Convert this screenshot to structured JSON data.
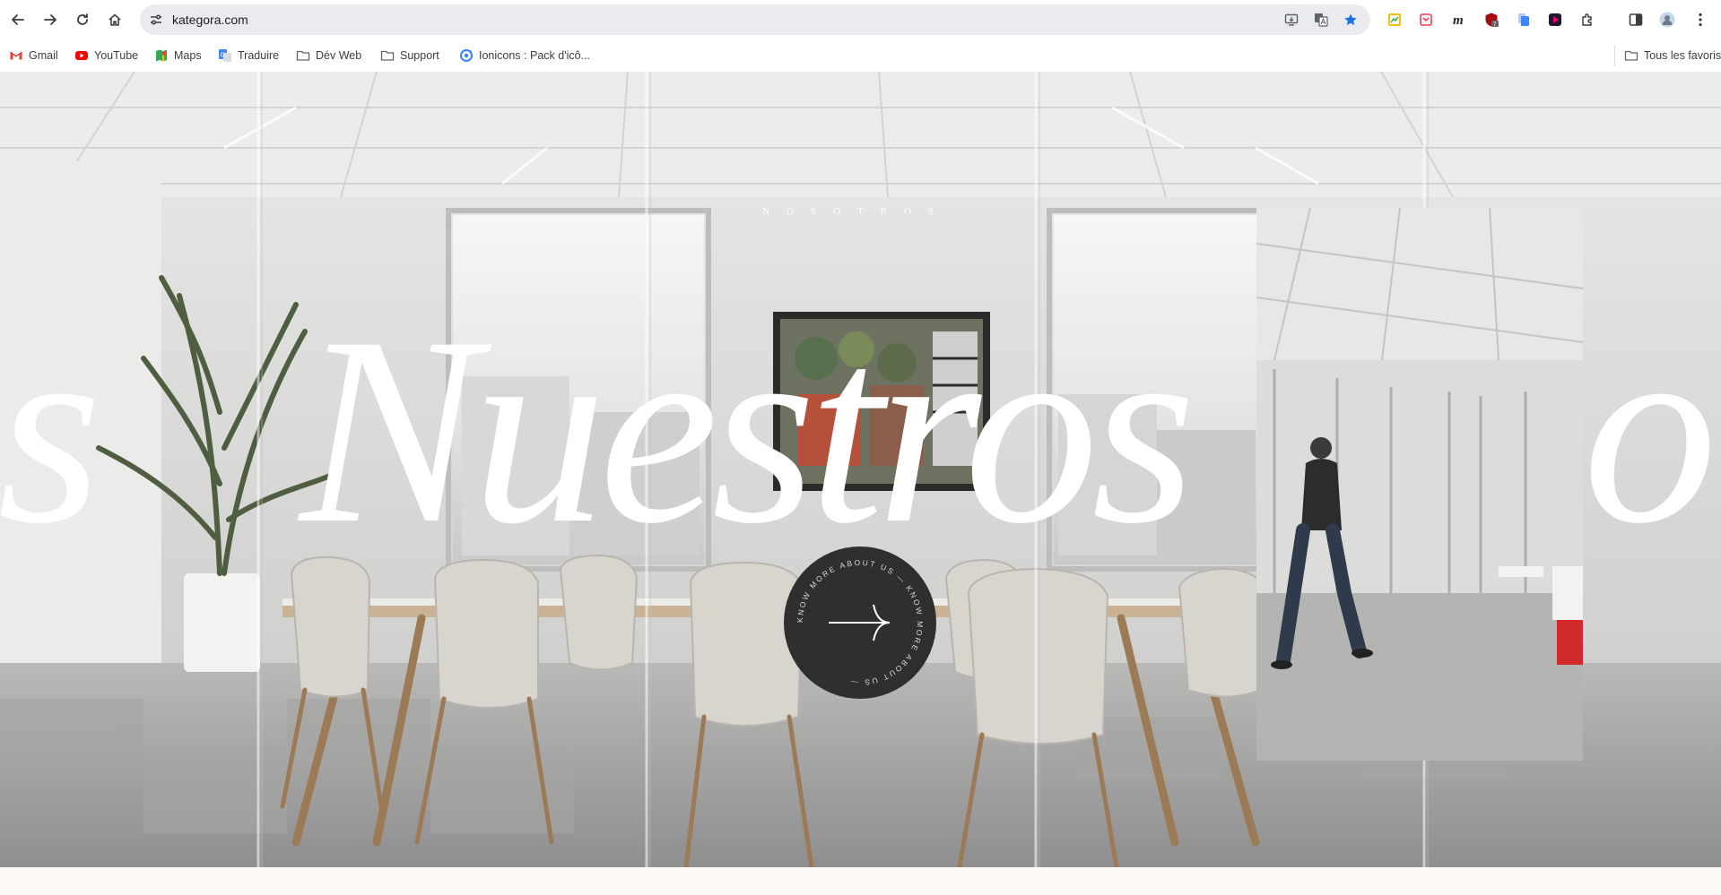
{
  "browser": {
    "url": "kategora.com",
    "bookmarks": [
      {
        "label": "Gmail",
        "icon": "gmail-icon"
      },
      {
        "label": "YouTube",
        "icon": "youtube-icon"
      },
      {
        "label": "Maps",
        "icon": "maps-icon"
      },
      {
        "label": "Traduire",
        "icon": "translate-icon"
      },
      {
        "label": "Dév Web",
        "icon": "folder-icon"
      },
      {
        "label": "Support",
        "icon": "folder-icon"
      },
      {
        "label": "Ionicons : Pack d'icô...",
        "icon": "ionicons-icon"
      }
    ],
    "all_bookmarks_label": "Tous les favoris",
    "extension_badge": "7"
  },
  "hero": {
    "section_label": "NOSOTROS",
    "big_word": "Nuestros",
    "big_word_left_fragment": "es",
    "big_word_right_fragment": "or",
    "cta_ring_text": "KNOW MORE ABOUT US — KNOW MORE ABOUT US — "
  },
  "colors": {
    "accent_star": "#1a73e8",
    "cta_background": "#2f2f2f",
    "page_background": "#fdf9f4"
  }
}
